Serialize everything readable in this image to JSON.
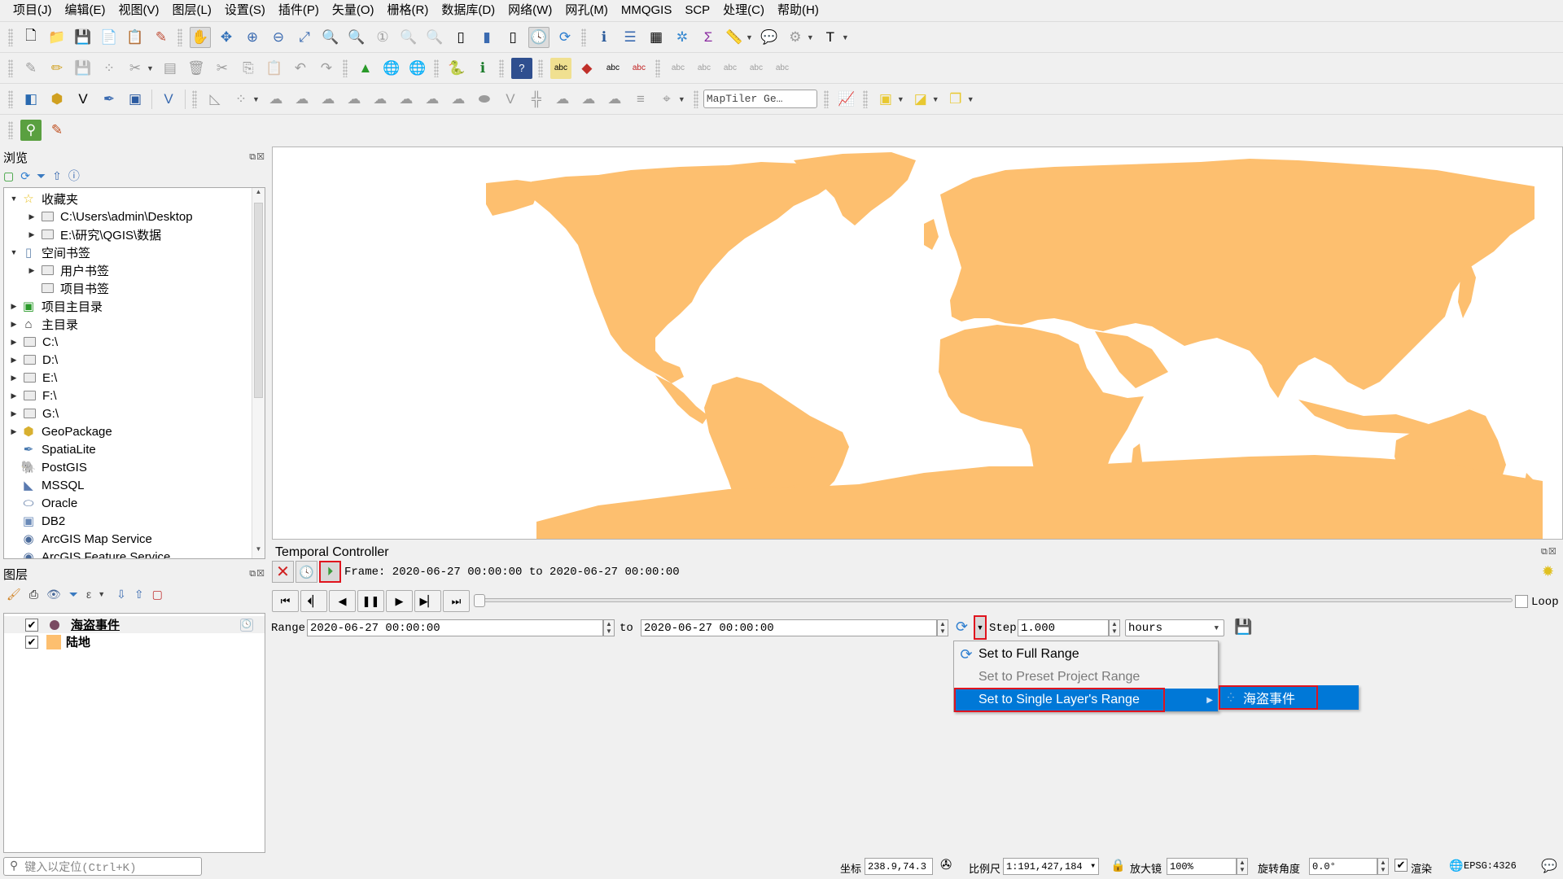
{
  "menubar": [
    "项目(J)",
    "编辑(E)",
    "视图(V)",
    "图层(L)",
    "设置(S)",
    "插件(P)",
    "矢量(O)",
    "栅格(R)",
    "数据库(D)",
    "网络(W)",
    "网孔(M)",
    "MMQGIS",
    "SCP",
    "处理(C)",
    "帮助(H)"
  ],
  "toolbar": {
    "row1_icons": [
      "new-project-icon",
      "open-project-icon",
      "save-project-icon",
      "save-as-icon",
      "print-layout-icon",
      "style-manager-icon",
      "pan-icon",
      "pan-to-selection-icon",
      "zoom-in-icon",
      "zoom-out-icon",
      "zoom-full-icon",
      "zoom-to-selection-icon",
      "zoom-to-layer-icon",
      "zoom-native-icon",
      "zoom-last-icon",
      "zoom-next-icon",
      "new-map-view-icon",
      "new-bookmark-icon",
      "show-bookmarks-icon",
      "temporal-controller-icon",
      "refresh-icon",
      "identify-icon",
      "attribute-table-icon",
      "field-calculator-icon",
      "statistics-icon",
      "measure-icon",
      "map-tips-icon",
      "locator-icon",
      "text-annotation-icon"
    ],
    "row2_icons": [
      "current-edits-icon",
      "toggle-editing-icon",
      "save-edits-icon",
      "add-point-icon",
      "vertex-tool-icon",
      "modify-attributes-icon",
      "delete-selected-icon",
      "cut-icon",
      "copy-icon",
      "paste-icon",
      "undo-icon",
      "redo-icon",
      "digitize-icon",
      "georeferencer-icon",
      "georeferencer-zoom-icon",
      "python-console-icon",
      "identify-plugin-icon",
      "help-icon",
      "label-icon",
      "label-pin-icon",
      "label-show-icon",
      "label-move-icon",
      "label-rotate-icon",
      "label-change-icon",
      "label-properties-icon"
    ],
    "row3_icons": [
      "new-geopackage-icon",
      "new-shapefile-icon",
      "new-spatialite-icon",
      "new-temporary-layer-icon",
      "new-virtual-layer-icon",
      "new-gpx-icon",
      "snapping-icon",
      "add-ring-icon",
      "fill-ring-icon",
      "delete-ring-icon",
      "delete-part-icon",
      "reshape-icon",
      "offset-curve-icon",
      "split-features-icon",
      "split-parts-icon",
      "merge-features-icon",
      "merge-attributes-icon",
      "rotate-point-icon",
      "simplify-icon",
      "add-part-icon",
      "trace-icon"
    ],
    "maptiler_placeholder": "MapTiler Ge…",
    "row3_right_icons": [
      "profile-tool-icon",
      "select-features-icon",
      "select-by-polygon-icon",
      "deselect-icon"
    ],
    "row4_icons": [
      "scp-search-icon",
      "scp-edit-icon"
    ]
  },
  "browser": {
    "title": "浏览",
    "toolbar_icons": [
      "add-selected-layers-icon",
      "refresh-icon",
      "filter-icon",
      "collapse-all-icon",
      "info-icon"
    ],
    "items": [
      {
        "label": "收藏夹",
        "level": 0,
        "expanded": true,
        "icon": "star-icon"
      },
      {
        "label": "C:\\Users\\admin\\Desktop",
        "level": 1,
        "expanded": false,
        "icon": "folder-icon"
      },
      {
        "label": "E:\\研究\\QGIS\\数据",
        "level": 1,
        "expanded": false,
        "icon": "folder-icon"
      },
      {
        "label": "空间书签",
        "level": 0,
        "expanded": true,
        "icon": "bookmark-icon"
      },
      {
        "label": "用户书签",
        "level": 1,
        "expanded": false,
        "icon": "folder-icon"
      },
      {
        "label": "项目书签",
        "level": 1,
        "expanded": null,
        "icon": "folder-icon"
      },
      {
        "label": "项目主目录",
        "level": 0,
        "expanded": false,
        "icon": "project-home-icon"
      },
      {
        "label": "主目录",
        "level": 0,
        "expanded": false,
        "icon": "home-icon"
      },
      {
        "label": "C:\\",
        "level": 0,
        "expanded": false,
        "icon": "folder-icon"
      },
      {
        "label": "D:\\",
        "level": 0,
        "expanded": false,
        "icon": "folder-icon"
      },
      {
        "label": "E:\\",
        "level": 0,
        "expanded": false,
        "icon": "folder-icon"
      },
      {
        "label": "F:\\",
        "level": 0,
        "expanded": false,
        "icon": "folder-icon"
      },
      {
        "label": "G:\\",
        "level": 0,
        "expanded": false,
        "icon": "folder-icon"
      },
      {
        "label": "GeoPackage",
        "level": 0,
        "expanded": false,
        "icon": "geopackage-icon"
      },
      {
        "label": "SpatiaLite",
        "level": 0,
        "expanded": null,
        "icon": "spatialite-icon"
      },
      {
        "label": "PostGIS",
        "level": 0,
        "expanded": null,
        "icon": "postgis-icon"
      },
      {
        "label": "MSSQL",
        "level": 0,
        "expanded": null,
        "icon": "mssql-icon"
      },
      {
        "label": "Oracle",
        "level": 0,
        "expanded": null,
        "icon": "oracle-icon"
      },
      {
        "label": "DB2",
        "level": 0,
        "expanded": null,
        "icon": "db2-icon"
      },
      {
        "label": "ArcGIS Map Service",
        "level": 0,
        "expanded": null,
        "icon": "arcgis-icon"
      },
      {
        "label": "ArcGIS Feature Service",
        "level": 0,
        "expanded": null,
        "icon": "arcgis-icon"
      }
    ]
  },
  "layers": {
    "title": "图层",
    "toolbar_icons": [
      "style-panel-icon",
      "add-group-icon",
      "manage-visibility-icon",
      "filter-legend-icon",
      "filter-expression-icon",
      "expand-all-icon",
      "collapse-all-icon",
      "remove-layer-icon"
    ],
    "items": [
      {
        "name": "海盗事件",
        "checked": true,
        "symbol": "point",
        "color": "#7a4a62",
        "temporal": true
      },
      {
        "name": "陆地",
        "checked": true,
        "symbol": "polygon",
        "color": "#fdbf6f",
        "temporal": false
      }
    ]
  },
  "map": {
    "land_color": "#fdbf6f",
    "background": "#ffffff"
  },
  "temporal": {
    "title": "Temporal Controller",
    "frame_label": "Frame: 2020-06-27 00:00:00 to 2020-06-27 00:00:00",
    "range_label": "Range",
    "range_start": "2020-06-27 00:00:00",
    "to_label": "to",
    "range_end": "2020-06-27 00:00:00",
    "step_label": "Step",
    "step_value": "1.000",
    "step_unit": "hours",
    "loop_label": "Loop",
    "loop_checked": false,
    "slider_position": 0,
    "playback_buttons": [
      "skip-to-start",
      "previous-frame",
      "play-backward",
      "pause",
      "play-forward",
      "next-frame",
      "skip-to-end"
    ]
  },
  "range_menu": {
    "items": [
      {
        "label": "Set to Full Range",
        "enabled": true
      },
      {
        "label": "Set to Preset Project Range",
        "enabled": false
      },
      {
        "label": "Set to Single Layer's Range",
        "enabled": true,
        "highlighted": true,
        "submenu": true
      }
    ],
    "submenu_items": [
      "海盗事件"
    ]
  },
  "locator": {
    "placeholder": "键入以定位(Ctrl+K)"
  },
  "statusbar": {
    "coord_label": "坐标",
    "coord_value": "238.9,74.3",
    "scale_label": "比例尺",
    "scale_value": "1:191,427,184",
    "magnifier_label": "放大镜",
    "magnifier_value": "100%",
    "rotation_label": "旋转角度",
    "rotation_value": "0.0°",
    "render_label": "渲染",
    "render_checked": true,
    "crs_label": "EPSG:4326"
  },
  "colors": {
    "accent_blue": "#0078d7",
    "highlight_red": "#e0141e"
  }
}
